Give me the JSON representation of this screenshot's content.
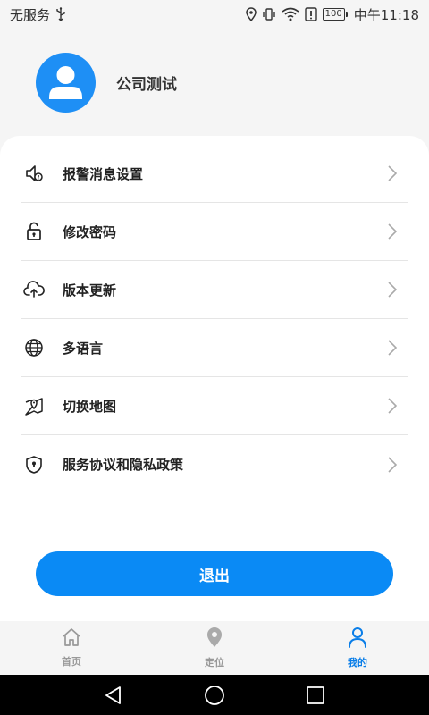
{
  "status_bar": {
    "carrier": "无服务",
    "battery": "100",
    "time": "中午11:18"
  },
  "profile": {
    "username": "公司测试"
  },
  "menu": [
    {
      "label": "报警消息设置",
      "icon": "alarm-speaker-icon"
    },
    {
      "label": "修改密码",
      "icon": "unlock-icon"
    },
    {
      "label": "版本更新",
      "icon": "cloud-upload-icon"
    },
    {
      "label": "多语言",
      "icon": "globe-icon"
    },
    {
      "label": "切换地图",
      "icon": "map-pin-icon"
    },
    {
      "label": "服务协议和隐私政策",
      "icon": "shield-icon"
    }
  ],
  "logout": {
    "label": "退出"
  },
  "tabs": [
    {
      "label": "首页",
      "icon": "home-icon",
      "active": false
    },
    {
      "label": "定位",
      "icon": "location-pin-icon",
      "active": false
    },
    {
      "label": "我的",
      "icon": "person-icon",
      "active": true
    }
  ],
  "colors": {
    "accent": "#0a8af5",
    "avatar_bg": "#1e8ff5",
    "active_tab": "#0a7ee8",
    "inactive_tab": "#999999"
  }
}
